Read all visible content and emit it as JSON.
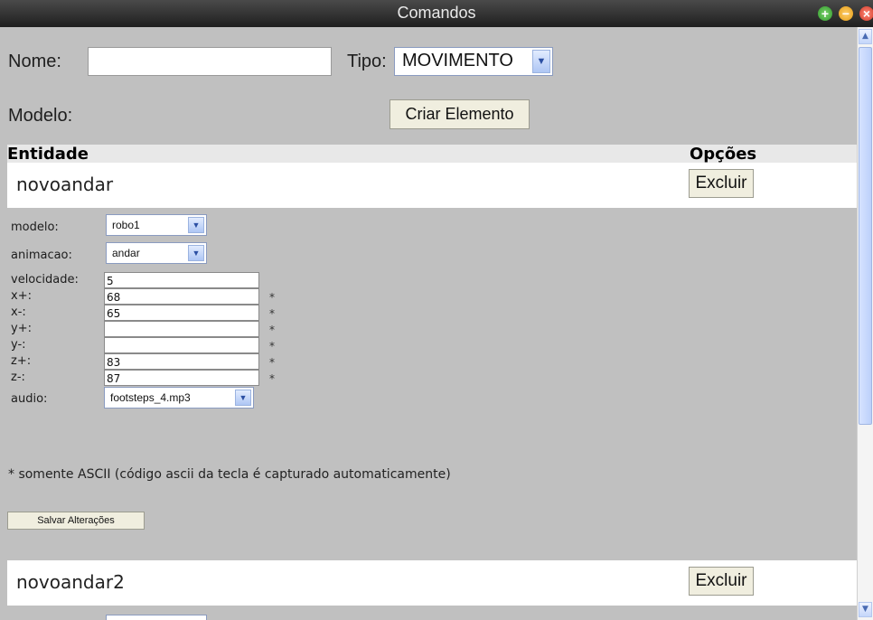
{
  "window": {
    "title": "Comandos"
  },
  "form": {
    "nome_label": "Nome:",
    "nome_value": "",
    "tipo_label": "Tipo:",
    "tipo_value": "MOVIMENTO",
    "modelo_label": "Modelo:",
    "criar_label": "Criar Elemento"
  },
  "table_header": {
    "entidade": "Entidade",
    "opcoes": "Opções"
  },
  "entities": [
    {
      "name": "novoandar",
      "delete_label": "Excluir",
      "fields": {
        "modelo_label": "modelo:",
        "modelo_value": "robo1",
        "animacao_label": "animacao:",
        "animacao_value": "andar",
        "velocidade_label": "velocidade:",
        "velocidade_value": "5",
        "xplus_label": "x+:",
        "xplus_value": "68",
        "xminus_label": "x-:",
        "xminus_value": "65",
        "yplus_label": "y+:",
        "yplus_value": "",
        "yminus_label": "y-:",
        "yminus_value": "",
        "zplus_label": "z+:",
        "zplus_value": "83",
        "zminus_label": "z-:",
        "zminus_value": "87",
        "audio_label": "audio:",
        "audio_value": "footsteps_4.mp3",
        "star": "*"
      },
      "note": "* somente ASCII (código ascii da tecla é capturado automaticamente)",
      "save_label": "Salvar Alterações"
    },
    {
      "name": "novoandar2",
      "delete_label": "Excluir"
    }
  ],
  "icons": {
    "maximize": "green-plus-icon",
    "minimize": "orange-minus-icon",
    "close": "red-close-icon",
    "dropdown": "chevron-down-icon",
    "scroll_up": "arrow-up-icon",
    "scroll_down": "arrow-down-icon"
  },
  "colors": {
    "background": "#c0c0c0",
    "titlebar": "#2a2a2a",
    "row": "#ffffff",
    "button": "#f0eedf"
  }
}
